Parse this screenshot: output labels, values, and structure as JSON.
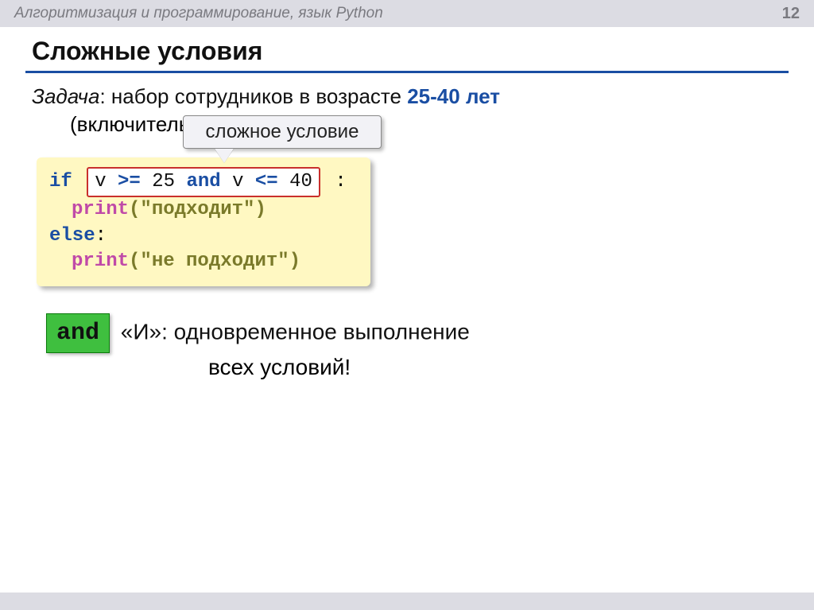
{
  "topbar": {
    "title": "Алгоритмизация и программирование, язык Python",
    "page": "12"
  },
  "heading": "Сложные условия",
  "task": {
    "label": "Задача",
    "text_before": ": набор сотрудников в возрасте ",
    "age": "25-40 лет",
    "sub": "(включительно)."
  },
  "callout": "сложное условие",
  "code": {
    "if_kw": "if",
    "cond": {
      "v1": "v",
      "op1": ">=",
      "n1": "25",
      "and_kw": "and",
      "v2": "v",
      "op2": "<=",
      "n2": "40"
    },
    "colon": ":",
    "print1_fn": "print",
    "print1_arg": "(\"подходит\")",
    "else_kw": "else",
    "else_colon": ":",
    "print2_fn": "print",
    "print2_arg": "(\"не подходит\")"
  },
  "explain": {
    "badge": "and",
    "line1_a": "«И»: ",
    "line1_b": "одновременное",
    "line1_c": " выполнение",
    "line2": "всех условий!"
  }
}
